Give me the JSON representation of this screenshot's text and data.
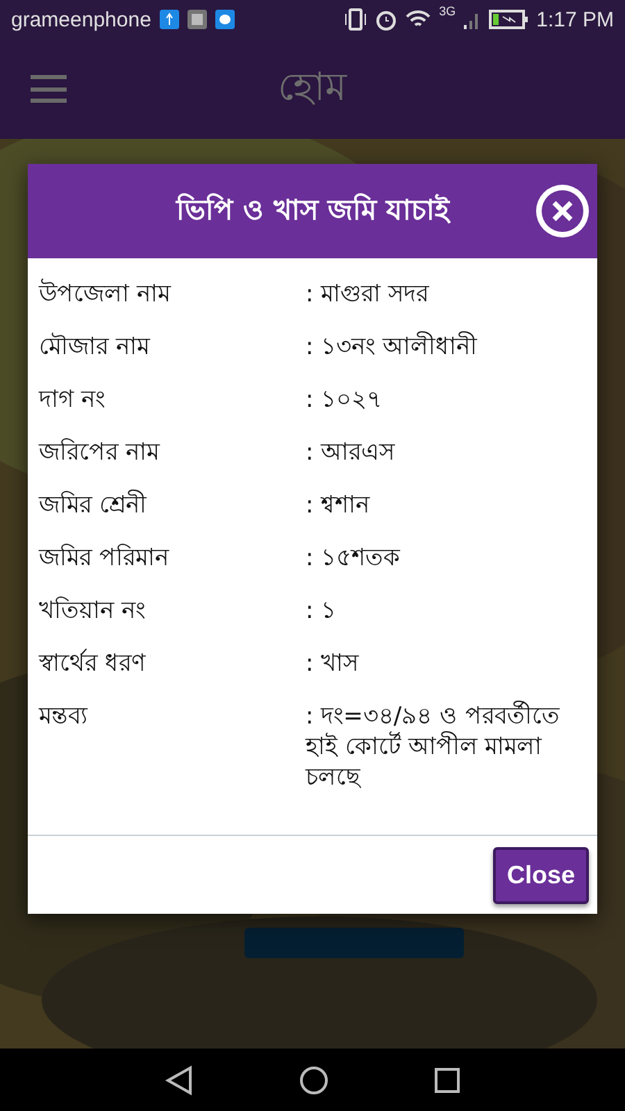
{
  "status_bar": {
    "carrier": "grameenphone",
    "network": "3G",
    "time": "1:17 PM"
  },
  "app_bar": {
    "title": "হোম"
  },
  "dialog": {
    "title": "ভিপি ও খাস জমি যাচাই",
    "rows": [
      {
        "label": "উপজেলা নাম",
        "value": ": মাগুরা সদর"
      },
      {
        "label": "মৌজার নাম",
        "value": ": ১৩নং আলীধানী"
      },
      {
        "label": "দাগ নং",
        "value": ": ১০২৭"
      },
      {
        "label": "জরিপের নাম",
        "value": ": আরএস"
      },
      {
        "label": "জমির শ্রেনী",
        "value": ": শ্বশান"
      },
      {
        "label": "জমির পরিমান",
        "value": ": ১৫শতক"
      },
      {
        "label": "খতিয়ান নং",
        "value": ": ১"
      },
      {
        "label": "স্বার্থের ধরণ",
        "value": ": খাস"
      },
      {
        "label": "মন্তব্য",
        "value": ": দং=৩৪/৯৪ ও পরবর্তীতে হাই কোর্টে আপীল মামলা চলছে"
      }
    ],
    "close_button": "Close"
  }
}
